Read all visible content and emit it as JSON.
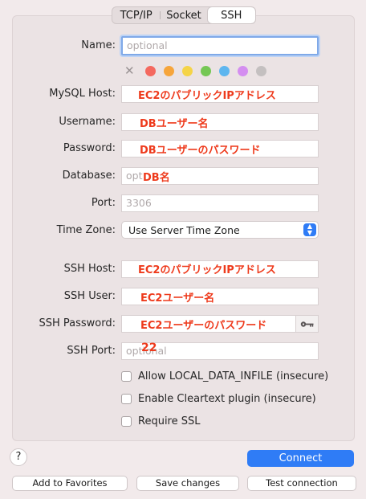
{
  "tabs": [
    {
      "label": "TCP/IP",
      "active": false
    },
    {
      "label": "Socket",
      "active": false
    },
    {
      "label": "SSH",
      "active": true
    }
  ],
  "form": {
    "name_label": "Name:",
    "name_placeholder": "optional",
    "mysql_host_label": "MySQL Host:",
    "mysql_host_note": "EC2のパブリックIPアドレス",
    "username_label": "Username:",
    "username_note": "DBユーザー名",
    "password_label": "Password:",
    "password_note": "DBユーザーのパスワード",
    "database_label": "Database:",
    "database_placeholder": "opt",
    "database_note": "DB名",
    "port_label": "Port:",
    "port_placeholder": "3306",
    "timezone_label": "Time Zone:",
    "timezone_value": "Use Server Time Zone",
    "ssh_host_label": "SSH Host:",
    "ssh_host_note": "EC2のパブリックIPアドレス",
    "ssh_user_label": "SSH User:",
    "ssh_user_note": "EC2ユーザー名",
    "ssh_password_label": "SSH Password:",
    "ssh_password_note": "EC2ユーザーのパスワード",
    "ssh_port_label": "SSH Port:",
    "ssh_port_placeholder": "optional",
    "ssh_port_note": "22"
  },
  "color_tags": [
    "#f4695f",
    "#f6a53b",
    "#f5d448",
    "#75c754",
    "#5eb6ef",
    "#d48ef0",
    "#c4c0c0"
  ],
  "checkboxes": [
    {
      "label": "Allow LOCAL_DATA_INFILE (insecure)",
      "checked": false
    },
    {
      "label": "Enable Cleartext plugin (insecure)",
      "checked": false
    },
    {
      "label": "Require SSL",
      "checked": false
    }
  ],
  "footer": {
    "help_label": "?",
    "connect_label": "Connect",
    "add_favorites_label": "Add to Favorites",
    "save_changes_label": "Save changes",
    "test_connection_label": "Test connection"
  }
}
